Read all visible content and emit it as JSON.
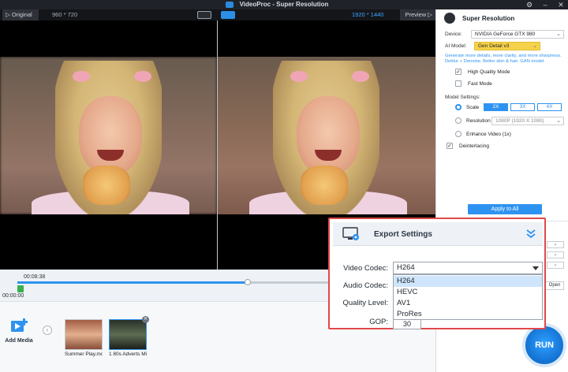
{
  "window": {
    "title": "VideoProc  -  Super Resolution"
  },
  "video_bar": {
    "original_label": "Original",
    "original_res": "960 * 720",
    "output_res": "1920 * 1440",
    "preview_label": "Preview"
  },
  "timeline": {
    "current_time": "00:08:38",
    "start_time": "00:00:00",
    "progress": 0.55
  },
  "media": {
    "add_media_label": "Add Media",
    "clips": [
      {
        "name": "Summer Play.mo"
      },
      {
        "name": "1 80s Adverts Mi"
      }
    ]
  },
  "panel": {
    "title": "Super Resolution",
    "device_label": "Device:",
    "device_value": "NVIDIA GeForce GTX 980",
    "ai_model_label": "AI Model:",
    "ai_model_value": "Gen Detail v3",
    "description": "Generate more details, more clarity, and more sharpness. Deblur + Denoise. Better skin & hair. GAN model.",
    "high_quality_label": "High Quality Mode",
    "fast_mode_label": "Fast Mode",
    "model_settings_label": "Model Settings:",
    "scale_label": "Scale",
    "scale_options": [
      "2X",
      "3X",
      "4X"
    ],
    "resolution_label": "Resolution",
    "resolution_value": "1080P (1920 X 1080)",
    "enhance_label": "Enhance Video (1x)",
    "deinterlacing_label": "Deinterlacing",
    "apply_label": "Apply to All",
    "open_label": "Open"
  },
  "export": {
    "title": "Export Settings",
    "video_codec_label": "Video Codec:",
    "video_codec_value": "H264",
    "audio_codec_label": "Audio Codec:",
    "quality_label": "Quality Level:",
    "gop_label": "GOP:",
    "gop_value": "30",
    "codec_options": [
      "H264",
      "HEVC",
      "AV1",
      "ProRes"
    ]
  },
  "run_label": "RUN",
  "colors": {
    "accent": "#2e93f0",
    "highlight_border": "#e0484b",
    "model_badge": "#f6d24b"
  }
}
